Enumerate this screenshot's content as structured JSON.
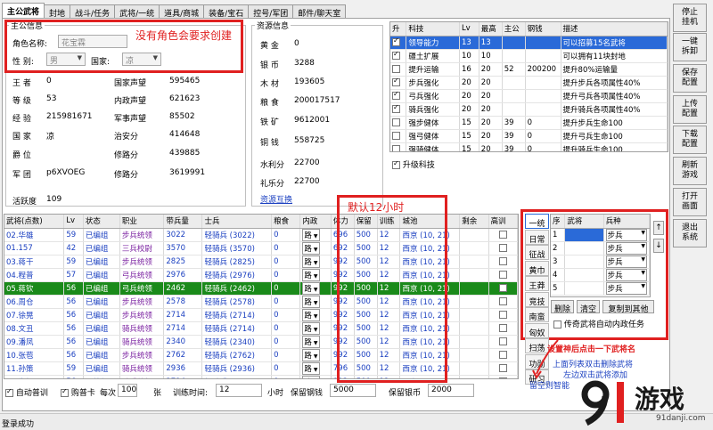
{
  "tabs": [
    "主公武将",
    "封地",
    "战斗/任务",
    "武将/一统",
    "道具/商城",
    "装备/宝石",
    "控号/军团",
    "邮件/聊天室"
  ],
  "lord": {
    "section_title": "主公信息",
    "name_label": "角色名称:",
    "name_value": "花宝霖",
    "gender_label": "性 别:",
    "gender_value": "男",
    "country_label": "国家:",
    "country_value": "凉",
    "note": "没有角色会要求创建",
    "stats": [
      {
        "label": "王 者",
        "value": "0",
        "label2": "国家声望",
        "value2": "595465"
      },
      {
        "label": "等 级",
        "value": "53",
        "label2": "内政声望",
        "value2": "621623"
      },
      {
        "label": "经 验",
        "value": "215981671",
        "label2": "军事声望",
        "value2": "85502"
      },
      {
        "label": "国 家",
        "value": "凉",
        "label2": "治安分",
        "value2": "414648"
      },
      {
        "label": "爵 位",
        "value": "",
        "label2": "修路分",
        "value2": "439885"
      },
      {
        "label": "军 团",
        "value": "p6XVOEG",
        "label2": "修路分",
        "value2": "3619991"
      }
    ],
    "activity_label": "活跃度",
    "activity_value": "109"
  },
  "resources": {
    "section_title": "资源信息",
    "items": [
      {
        "label": "黄 金",
        "value": "0"
      },
      {
        "label": "银 币",
        "value": "3288"
      },
      {
        "label": "木 材",
        "value": "193605"
      },
      {
        "label": "粮 食",
        "value": "200017517"
      },
      {
        "label": "铁 矿",
        "value": "9612001"
      },
      {
        "label": "铜 钱",
        "value": "558725"
      },
      {
        "label": "水利分",
        "value": "22700"
      },
      {
        "label": "礼乐分",
        "value": "22700"
      }
    ],
    "link": "资源互换"
  },
  "tech": {
    "headers": [
      "升",
      "科技",
      "Lv",
      "最高",
      "主公",
      "钢钱",
      "描述"
    ],
    "rows": [
      {
        "checked": true,
        "name": "领导能力",
        "lv": "13",
        "max": "13",
        "lord": "",
        "cost": "",
        "desc": "可以招募15名武将",
        "selected": true
      },
      {
        "checked": true,
        "name": "疆土扩展",
        "lv": "10",
        "max": "10",
        "lord": "",
        "cost": "",
        "desc": "可以拥有11块封地",
        "selected": false
      },
      {
        "checked": false,
        "name": "提升运输",
        "lv": "16",
        "max": "20",
        "lord": "52",
        "cost": "200200",
        "desc": "提升80%运输量",
        "selected": false
      },
      {
        "checked": true,
        "name": "步兵强化",
        "lv": "20",
        "max": "20",
        "lord": "",
        "cost": "",
        "desc": "提升步兵各项属性40%",
        "selected": false
      },
      {
        "checked": true,
        "name": "弓兵强化",
        "lv": "20",
        "max": "20",
        "lord": "",
        "cost": "",
        "desc": "提升弓兵各项属性40%",
        "selected": false
      },
      {
        "checked": true,
        "name": "骑兵强化",
        "lv": "20",
        "max": "20",
        "lord": "",
        "cost": "",
        "desc": "提升骑兵各项属性40%",
        "selected": false
      },
      {
        "checked": false,
        "name": "强步健体",
        "lv": "15",
        "max": "20",
        "lord": "39",
        "cost": "0",
        "desc": "提升步兵生命100",
        "selected": false
      },
      {
        "checked": false,
        "name": "强弓健体",
        "lv": "15",
        "max": "20",
        "lord": "39",
        "cost": "0",
        "desc": "提升弓兵生命100",
        "selected": false
      },
      {
        "checked": false,
        "name": "强骑健体",
        "lv": "15",
        "max": "20",
        "lord": "39",
        "cost": "0",
        "desc": "提升骑兵生命100",
        "selected": false
      }
    ],
    "upgrade_label": "升级科技"
  },
  "side_buttons": [
    "停止\n挂机",
    "一键\n拆卸",
    "保存\n配置",
    "上传\n配置",
    "下载\n配置",
    "刷新\n游戏",
    "打开\n画面",
    "退出\n系统"
  ],
  "generals": {
    "headers": [
      "武将(点数)",
      "Lv",
      "状态",
      "职业",
      "带兵量",
      "士兵",
      "粮食",
      "内政",
      "体力",
      "保留",
      "训练",
      "城池",
      "剩余",
      "高训"
    ],
    "rows": [
      {
        "name": "02.华雄",
        "lv": "59",
        "status": "已编组",
        "job": "步兵统领",
        "troop": "3022",
        "soldier": "轻骑兵 (3022)",
        "food": "0",
        "gov": "路",
        "hp": "696",
        "keep": "500",
        "train": "12",
        "city": "西京 (10, 21)",
        "selected": false
      },
      {
        "name": "01.157",
        "lv": "42",
        "status": "已编组",
        "job": "三兵校尉",
        "troop": "3570",
        "soldier": "轻骑兵 (3570)",
        "food": "0",
        "gov": "路",
        "hp": "692",
        "keep": "500",
        "train": "12",
        "city": "西京 (10, 21)",
        "selected": false
      },
      {
        "name": "03.蒋干",
        "lv": "59",
        "status": "已编组",
        "job": "步兵统领",
        "troop": "2825",
        "soldier": "轻骑兵 (2825)",
        "food": "0",
        "gov": "路",
        "hp": "992",
        "keep": "500",
        "train": "12",
        "city": "西京 (10, 21)",
        "selected": false
      },
      {
        "name": "04.程普",
        "lv": "57",
        "status": "已编组",
        "job": "弓兵统领",
        "troop": "2976",
        "soldier": "轻骑兵 (2976)",
        "food": "0",
        "gov": "路",
        "hp": "992",
        "keep": "500",
        "train": "12",
        "city": "西京 (10, 21)",
        "selected": false
      },
      {
        "name": "05.蒋钦",
        "lv": "56",
        "status": "已编组",
        "job": "弓兵统领",
        "troop": "2462",
        "soldier": "轻骑兵 (2462)",
        "food": "0",
        "gov": "路",
        "hp": "992",
        "keep": "500",
        "train": "12",
        "city": "西京 (10, 21)",
        "selected": true
      },
      {
        "name": "06.周仓",
        "lv": "56",
        "status": "已编组",
        "job": "步兵统领",
        "troop": "2578",
        "soldier": "轻骑兵 (2578)",
        "food": "0",
        "gov": "路",
        "hp": "992",
        "keep": "500",
        "train": "12",
        "city": "西京 (10, 21)",
        "selected": false
      },
      {
        "name": "07.徐晃",
        "lv": "56",
        "status": "已编组",
        "job": "步兵统领",
        "troop": "2714",
        "soldier": "轻骑兵 (2714)",
        "food": "0",
        "gov": "路",
        "hp": "992",
        "keep": "500",
        "train": "12",
        "city": "西京 (10, 21)",
        "selected": false
      },
      {
        "name": "08.文丑",
        "lv": "56",
        "status": "已编组",
        "job": "骑兵统领",
        "troop": "2714",
        "soldier": "轻骑兵 (2714)",
        "food": "0",
        "gov": "路",
        "hp": "992",
        "keep": "500",
        "train": "12",
        "city": "西京 (10, 21)",
        "selected": false
      },
      {
        "name": "09.潘凤",
        "lv": "56",
        "status": "已编组",
        "job": "骑兵统领",
        "troop": "2340",
        "soldier": "轻骑兵 (2340)",
        "food": "0",
        "gov": "路",
        "hp": "992",
        "keep": "500",
        "train": "12",
        "city": "西京 (10, 21)",
        "selected": false
      },
      {
        "name": "10.张苞",
        "lv": "56",
        "status": "已编组",
        "job": "步兵统领",
        "troop": "2762",
        "soldier": "轻骑兵 (2762)",
        "food": "0",
        "gov": "路",
        "hp": "992",
        "keep": "500",
        "train": "12",
        "city": "西京 (10, 21)",
        "selected": false
      },
      {
        "name": "11.孙策",
        "lv": "59",
        "status": "已编组",
        "job": "骑兵统领",
        "troop": "2936",
        "soldier": "轻骑兵 (2936)",
        "food": "0",
        "gov": "路",
        "hp": "796",
        "keep": "500",
        "train": "12",
        "city": "西京 (10, 21)",
        "selected": false
      },
      {
        "name": "12.朱桓",
        "lv": "56",
        "status": "已编组",
        "job": "骑兵统领",
        "troop": "2714",
        "soldier": "轻骑兵 (2714)",
        "food": "0",
        "gov": "路",
        "hp": "992",
        "keep": "500",
        "train": "12",
        "city": "西京 (10, 21)",
        "selected": false
      }
    ],
    "train_note": "默认12小时"
  },
  "formation": {
    "tabs_left": [
      "一统",
      "日常",
      "征战",
      "黄巾",
      "王莽",
      "竞技",
      "南蛮",
      "匈奴",
      "扫荡",
      "功勋",
      "研习"
    ],
    "headers": [
      "序",
      "武将",
      "兵种"
    ],
    "rows": [
      {
        "idx": "1",
        "general": "",
        "type": "步兵"
      },
      {
        "idx": "2",
        "general": "",
        "type": "步兵"
      },
      {
        "idx": "3",
        "general": "",
        "type": "步兵"
      },
      {
        "idx": "4",
        "general": "",
        "type": "步兵"
      },
      {
        "idx": "5",
        "general": "",
        "type": "步兵"
      }
    ],
    "clear_label": "删除",
    "empty_label": "清空",
    "copy_label": "复制到其他",
    "auto_task_label": "传奇武将自动内政任务",
    "hint1": "设置神后点击一下武将名",
    "hint2": "上面列表双击删除武将",
    "hint3": "左边双击武将添加",
    "hint4": "留空则智能"
  },
  "bottom": {
    "auto_train_label": "自动普训",
    "buy_card_label": "购普卡",
    "each_label": "每次",
    "each_value": "100",
    "zhang_label": "张",
    "train_time_label": "训练时间:",
    "train_time_value": "12",
    "hours_label": "小时",
    "keep_copper_label": "保留钢钱",
    "keep_copper_value": "5000",
    "keep_silver_label": "保留银币",
    "keep_silver_value": "2000"
  },
  "status_bar": "登录成功",
  "watermark": {
    "brand": "游戏",
    "url": "91danji.com"
  }
}
